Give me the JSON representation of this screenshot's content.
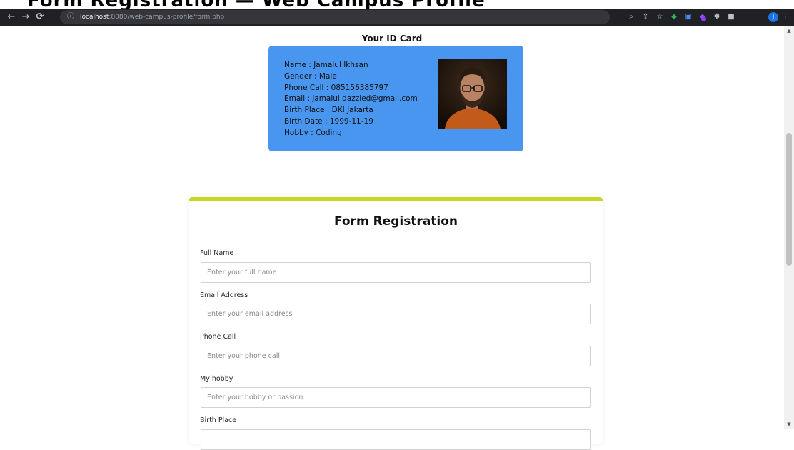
{
  "banner": {
    "heading": "Form Registration — Web Campus Profile"
  },
  "browser": {
    "url_host": "localhost",
    "url_path": ":8080/web-campus-profile/form.php",
    "profile_initial": "J"
  },
  "id_card": {
    "title": "Your ID Card",
    "lines": [
      "Name : Jamalul Ikhsan",
      "Gender : Male",
      "Phone Call : 085156385797",
      "Email : jamalul.dazzled@gmail.com",
      "Birth Place : DKI Jakarta",
      "Birth Date : 1999-11-19",
      "Hobby : Coding"
    ]
  },
  "form": {
    "title": "Form Registration",
    "accent_color": "#c9d624",
    "fields": [
      {
        "label": "Full Name",
        "placeholder": "Enter your full name"
      },
      {
        "label": "Email Address",
        "placeholder": "Enter your email address"
      },
      {
        "label": "Phone Call",
        "placeholder": "Enter your phone call"
      },
      {
        "label": "My hobby",
        "placeholder": "Enter your hobby or passion"
      },
      {
        "label": "Birth Place",
        "placeholder": ""
      }
    ]
  },
  "colors": {
    "card_bg": "#4896f0",
    "toolbar_bg": "#202124"
  }
}
